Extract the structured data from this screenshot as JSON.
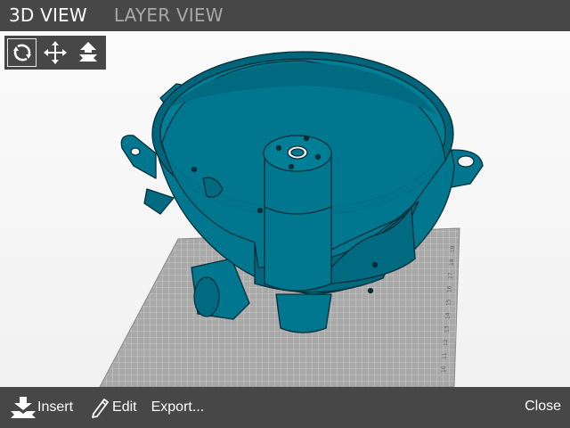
{
  "tabs": {
    "view_3d": "3D VIEW",
    "layer_view": "LAYER VIEW"
  },
  "toolbox": {
    "tools": [
      "rotate-icon",
      "move-icon",
      "lay-flat-icon"
    ],
    "selected": "rotate-icon"
  },
  "bed": {
    "ruler_labels": [
      "10",
      "11",
      "12",
      "13",
      "14",
      "15",
      "16",
      "17",
      "18",
      "19"
    ]
  },
  "bottom": {
    "insert_label": "Insert",
    "edit_label": "Edit",
    "export_label": "Export...",
    "close_label": "Close"
  },
  "colors": {
    "bar": "#474747",
    "model": "#00778f",
    "model_dark": "#004d5e",
    "bed": "#a9a9a9",
    "grid": "#d2d2d2"
  }
}
